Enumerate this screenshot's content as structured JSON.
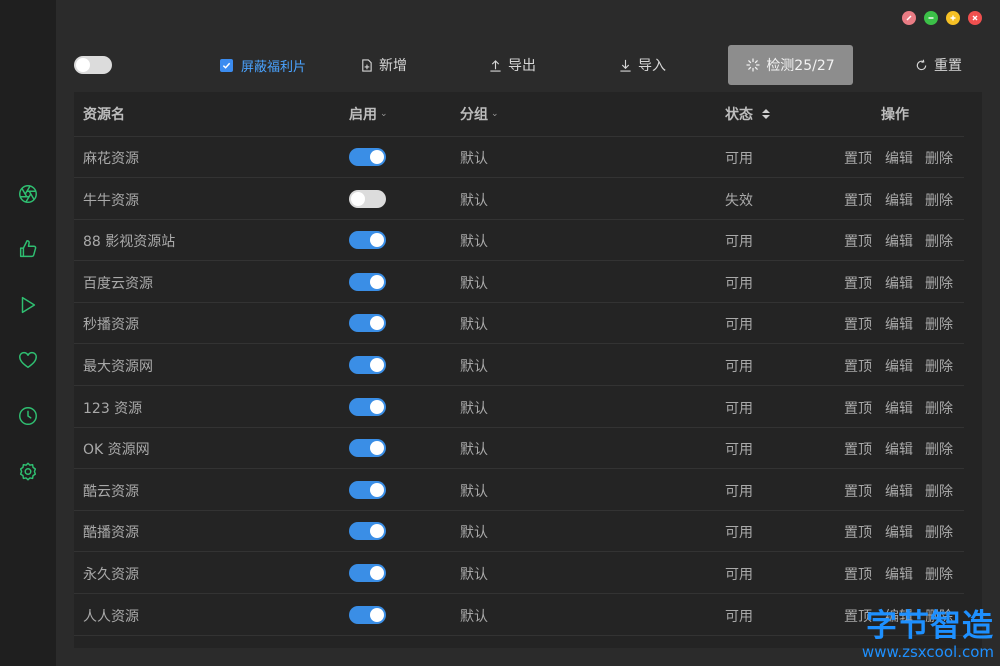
{
  "toolbar": {
    "block_label": "屏蔽福利片",
    "add_label": "新增",
    "export_label": "导出",
    "import_label": "导入",
    "detect_label": "检测25/27",
    "reset_label": "重置"
  },
  "table": {
    "headers": {
      "name": "资源名",
      "enabled": "启用",
      "group": "分组",
      "status": "状态",
      "actions": "操作"
    },
    "action_labels": {
      "top": "置顶",
      "edit": "编辑",
      "delete": "删除"
    },
    "rows": [
      {
        "name": "麻花资源",
        "enabled": true,
        "group": "默认",
        "status": "可用"
      },
      {
        "name": "牛牛资源",
        "enabled": false,
        "group": "默认",
        "status": "失效"
      },
      {
        "name": "88 影视资源站",
        "enabled": true,
        "group": "默认",
        "status": "可用"
      },
      {
        "name": "百度云资源",
        "enabled": true,
        "group": "默认",
        "status": "可用"
      },
      {
        "name": "秒播资源",
        "enabled": true,
        "group": "默认",
        "status": "可用"
      },
      {
        "name": "最大资源网",
        "enabled": true,
        "group": "默认",
        "status": "可用"
      },
      {
        "name": "123 资源",
        "enabled": true,
        "group": "默认",
        "status": "可用"
      },
      {
        "name": "OK 资源网",
        "enabled": true,
        "group": "默认",
        "status": "可用"
      },
      {
        "name": "酷云资源",
        "enabled": true,
        "group": "默认",
        "status": "可用"
      },
      {
        "name": "酷播资源",
        "enabled": true,
        "group": "默认",
        "status": "可用"
      },
      {
        "name": "永久资源",
        "enabled": true,
        "group": "默认",
        "status": "可用"
      },
      {
        "name": "人人资源",
        "enabled": true,
        "group": "默认",
        "status": "可用"
      }
    ]
  },
  "watermark": {
    "logo": "字节智造",
    "url": "www.zsxcool.com"
  },
  "sidebar_icons": [
    "aperture-icon",
    "thumbs-up-icon",
    "play-icon",
    "heart-icon",
    "clock-icon",
    "settings-icon"
  ],
  "colors": {
    "accent": "#3a8ee6",
    "sidebar_icon": "#2fbf71",
    "window_close": "#f0504f",
    "window_max": "#f5c025",
    "window_min": "#3cc048",
    "window_pin": "#e97c84"
  }
}
